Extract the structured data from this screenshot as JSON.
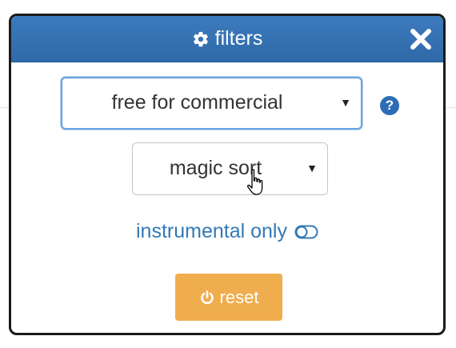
{
  "dialog": {
    "title": "filters",
    "title_icon": "gear-icon",
    "close_icon": "close-icon",
    "header_color": "#337ab7"
  },
  "license_select": {
    "selected": "free for commercial",
    "caret": "▼"
  },
  "help": {
    "glyph": "?"
  },
  "sort_select": {
    "selected": "magic sort",
    "caret": "▼"
  },
  "instrumental_toggle": {
    "label": "instrumental only",
    "icon": "toggle-off-icon",
    "state": "off"
  },
  "reset_button": {
    "label": "reset",
    "icon": "power-icon",
    "color": "#f0ad4e"
  },
  "accent_color": "#3379b7"
}
